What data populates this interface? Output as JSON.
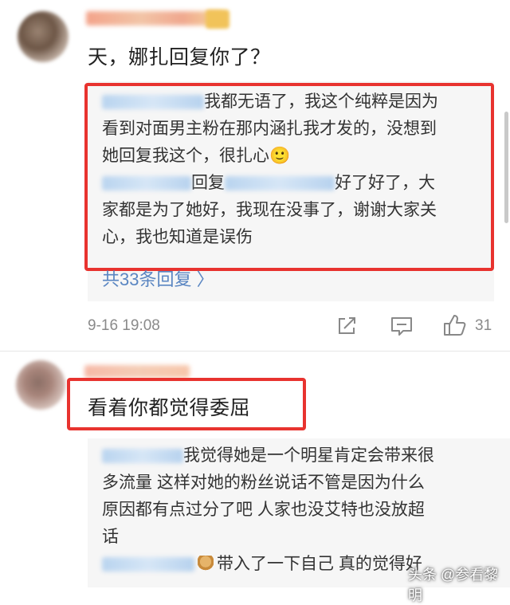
{
  "comments": [
    {
      "text": "天，娜扎回复你了？",
      "replies": [
        {
          "text": "我都无语了，我这个纯粹是因为"
        },
        {
          "text": "看到对面男主粉在那内涵扎我才发的，没想到"
        },
        {
          "text": "她回复我这个，很扎心🙂"
        },
        {
          "mid": "回复",
          "text": "好了好了，大"
        },
        {
          "text": "家都是为了她好，我现在没事了，谢谢大家关"
        },
        {
          "text": "心，我也知道是误伤"
        }
      ],
      "reply_count_link": "共33条回复 〉",
      "timestamp": "9-16 19:08",
      "like_count": "31"
    },
    {
      "text": "看着你都觉得委屈",
      "replies": [
        {
          "text": "我觉得她是一个明星肯定会带来很"
        },
        {
          "text": "多流量  这样对她的粉丝说话不管是因为什么"
        },
        {
          "text": "原因都有点过分了吧  人家也没艾特也没放超"
        },
        {
          "text": "话"
        },
        {
          "text": "带入了一下自己  真的觉得好"
        }
      ]
    }
  ],
  "watermark": "头条 @参看黎明",
  "colors": {
    "highlight": "#e8332f",
    "link": "#5a86c2"
  }
}
